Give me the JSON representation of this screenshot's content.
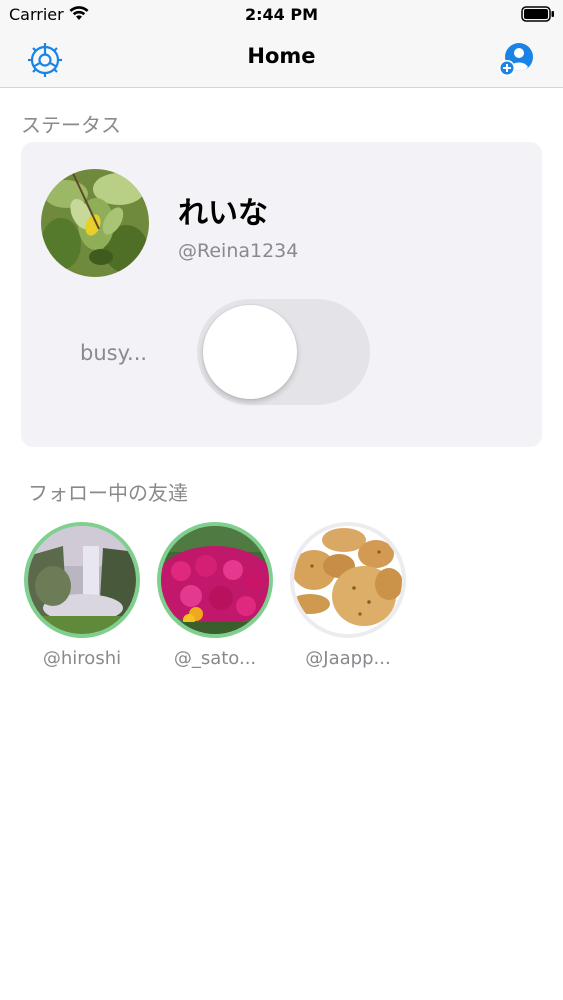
{
  "status_bar": {
    "carrier": "Carrier",
    "time": "2:44 PM",
    "wifi_icon": "wifi-icon",
    "battery_icon": "battery-icon"
  },
  "nav": {
    "title": "Home",
    "settings_icon": "settings-gear-icon",
    "add_friend_icon": "add-user-icon",
    "accent_color": "#1a84e6"
  },
  "status_section": {
    "label": "ステータス",
    "display_name": "れいな",
    "handle": "@Reina1234",
    "avatar_image": "citrus-leaves-photo",
    "status_label": "busy...",
    "status_toggle_on": false
  },
  "friends_section": {
    "label": "フォロー中の友達",
    "online_color": "#7fd08f",
    "friends": [
      {
        "handle": "@hiroshi",
        "image": "waterfall-photo",
        "online": true
      },
      {
        "handle": "@_sato...",
        "image": "pink-flowers-photo",
        "online": true
      },
      {
        "handle": "@Jaapp...",
        "image": "cookies-photo",
        "online": false
      }
    ]
  }
}
